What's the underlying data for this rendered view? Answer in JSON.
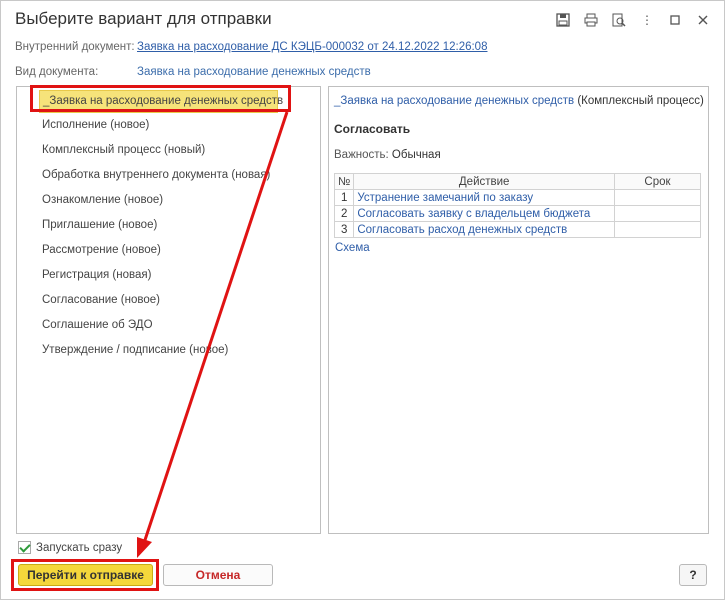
{
  "window": {
    "title": "Выберите вариант для отправки",
    "icons": [
      "save-icon",
      "print-icon",
      "preview-icon",
      "more-icon",
      "maximize-icon",
      "close-icon"
    ]
  },
  "fields": {
    "internal_doc_label": "Внутренний документ:",
    "internal_doc_value": "Заявка на расходование ДС КЭЦБ-000032 от 24.12.2022 12:26:08",
    "doc_type_label": "Вид документа:",
    "doc_type_value": "Заявка на расходование денежных средств"
  },
  "variants": [
    "_Заявка на расходование денежных средств",
    "Исполнение (новое)",
    "Комплексный процесс (новый)",
    "Обработка внутреннего документа (новая)",
    "Ознакомление (новое)",
    "Приглашение (новое)",
    "Рассмотрение (новое)",
    "Регистрация (новая)",
    "Согласование (новое)",
    "Соглашение об  ЭДО",
    "Утверждение / подписание (новое)"
  ],
  "selected_index": 0,
  "detail": {
    "name_link": "_Заявка на расходование денежных средств",
    "name_suffix": " (Комплексный процесс)",
    "step_title": "Согласовать",
    "importance_label": "Важность:",
    "importance_value": " Обычная",
    "table_headers": [
      "№",
      "Действие",
      "Срок"
    ],
    "rows": [
      {
        "num": "1",
        "action": "Устранение замечаний по заказу",
        "due": ""
      },
      {
        "num": "2",
        "action": "Согласовать заявку с владельцем бюджета",
        "due": ""
      },
      {
        "num": "3",
        "action": "Согласовать расход денежных средств",
        "due": ""
      }
    ],
    "schema_link": "Схема"
  },
  "footer": {
    "start_now_label": "Запускать сразу",
    "start_now_checked": true,
    "go_button": "Перейти к отправке",
    "cancel_button": "Отмена",
    "help_button": "?"
  },
  "colors": {
    "highlight": "#e01313",
    "accent_yellow": "#f4d73b",
    "link": "#2f5ea8",
    "cancel_text": "#c62828"
  }
}
